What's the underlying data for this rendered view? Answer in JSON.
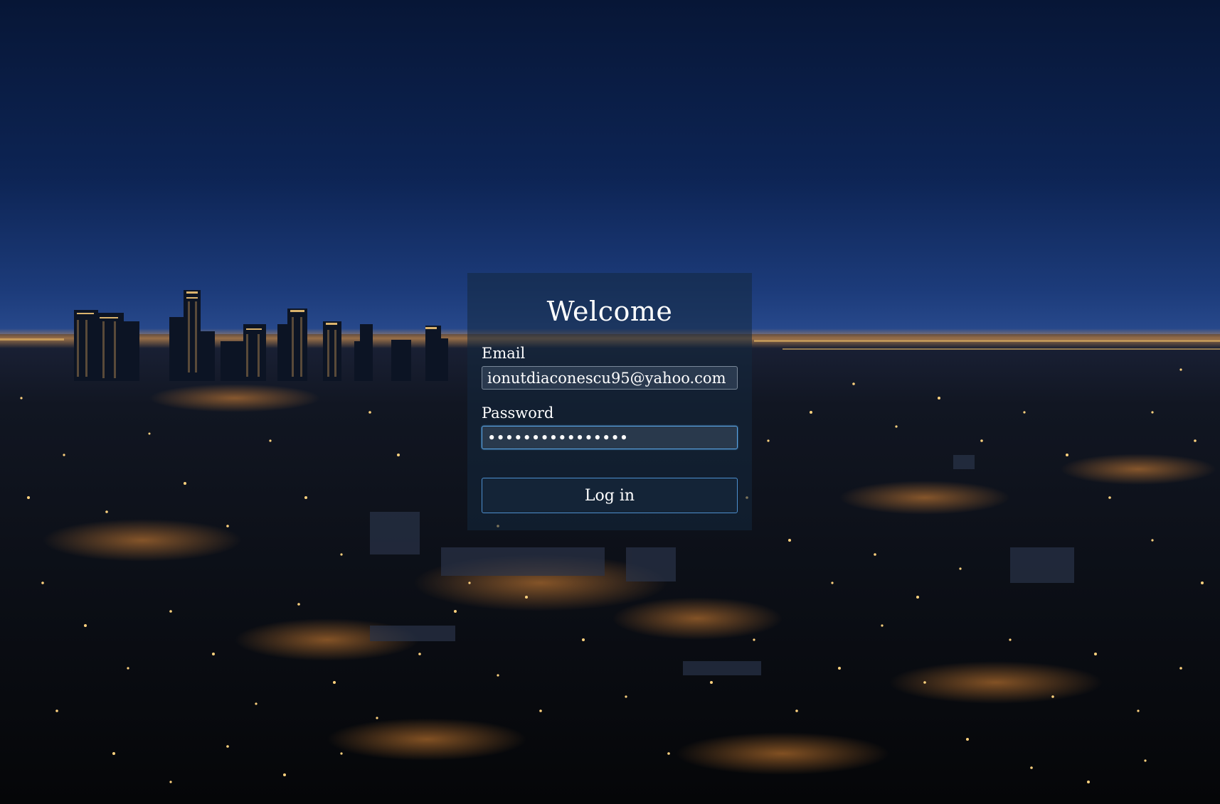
{
  "login": {
    "title": "Welcome",
    "email_label": "Email",
    "email_value": "ionutdiaconescu95@yahoo.com",
    "password_label": "Password",
    "password_value": "••••••••••••••••",
    "submit_label": "Log in"
  },
  "colors": {
    "sky_top": "#081a40",
    "sky_horizon": "#2a4f94",
    "city_dark": "#05070c",
    "light_warm": "#ffb84d",
    "input_focus_border": "#5aa6e6",
    "button_border": "#4d8fcf"
  }
}
